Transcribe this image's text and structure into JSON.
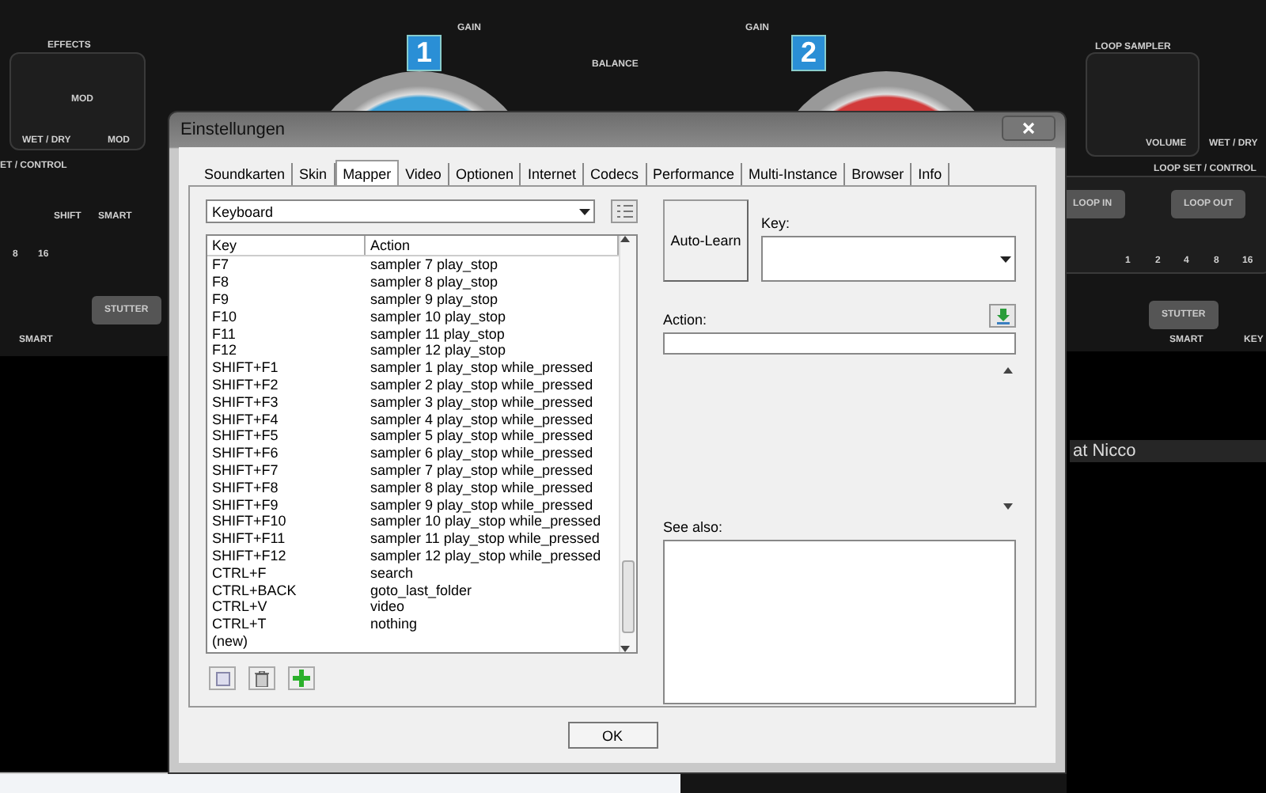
{
  "background_labels": [
    {
      "kind": "label",
      "text": "EFFECTS"
    },
    {
      "kind": "label",
      "text": "MOD"
    },
    {
      "kind": "label",
      "text": "WET / DRY"
    },
    {
      "kind": "label",
      "text": "MOD"
    },
    {
      "kind": "label",
      "text": "ET / CONTROL"
    },
    {
      "kind": "label",
      "text": "SHIFT"
    },
    {
      "kind": "label",
      "text": "SMART"
    },
    {
      "kind": "label",
      "text": "8"
    },
    {
      "kind": "label",
      "text": "16"
    },
    {
      "kind": "button",
      "text": "STUTTER"
    },
    {
      "kind": "label",
      "text": "SMART"
    },
    {
      "kind": "deck",
      "text": "1"
    },
    {
      "kind": "label",
      "text": "GAIN"
    },
    {
      "kind": "label",
      "text": "BALANCE"
    },
    {
      "kind": "label",
      "text": "GAIN"
    },
    {
      "kind": "deck",
      "text": "2"
    },
    {
      "kind": "label",
      "text": "LOOP SAMPLER"
    },
    {
      "kind": "label",
      "text": "VOLUME"
    },
    {
      "kind": "label",
      "text": "WET / DRY"
    },
    {
      "kind": "label",
      "text": "LOOP SET / CONTROL"
    },
    {
      "kind": "button",
      "text": "LOOP IN"
    },
    {
      "kind": "button",
      "text": "LOOP OUT"
    },
    {
      "kind": "label",
      "text": "1"
    },
    {
      "kind": "label",
      "text": "2"
    },
    {
      "kind": "label",
      "text": "4"
    },
    {
      "kind": "label",
      "text": "8"
    },
    {
      "kind": "label",
      "text": "16"
    },
    {
      "kind": "button",
      "text": "STUTTER"
    },
    {
      "kind": "label",
      "text": "SMART"
    },
    {
      "kind": "label",
      "text": "KEY"
    },
    {
      "kind": "row",
      "text": "at Nicco"
    }
  ],
  "window": {
    "title": "Einstellungen"
  },
  "tabs": [
    {
      "label": "Soundkarten",
      "selected": false
    },
    {
      "label": "Skin",
      "selected": false
    },
    {
      "label": "Mapper",
      "selected": true
    },
    {
      "label": "Video",
      "selected": false
    },
    {
      "label": "Optionen",
      "selected": false
    },
    {
      "label": "Internet",
      "selected": false
    },
    {
      "label": "Codecs",
      "selected": false
    },
    {
      "label": "Performance",
      "selected": false
    },
    {
      "label": "Multi-Instance",
      "selected": false
    },
    {
      "label": "Browser",
      "selected": false
    },
    {
      "label": "Info",
      "selected": false
    }
  ],
  "device": {
    "value": "Keyboard"
  },
  "table": {
    "columns": [
      "Key",
      "Action"
    ],
    "rows": [
      {
        "key": "F7",
        "action": "sampler  7 play_stop"
      },
      {
        "key": "F8",
        "action": "sampler  8 play_stop"
      },
      {
        "key": "F9",
        "action": "sampler  9 play_stop"
      },
      {
        "key": "F10",
        "action": "sampler  10 play_stop"
      },
      {
        "key": "F11",
        "action": "sampler  11 play_stop"
      },
      {
        "key": "F12",
        "action": "sampler  12 play_stop"
      },
      {
        "key": "SHIFT+F1",
        "action": "sampler  1 play_stop while_pressed"
      },
      {
        "key": "SHIFT+F2",
        "action": "sampler  2 play_stop while_pressed"
      },
      {
        "key": "SHIFT+F3",
        "action": "sampler  3 play_stop while_pressed"
      },
      {
        "key": "SHIFT+F4",
        "action": "sampler  4 play_stop while_pressed"
      },
      {
        "key": "SHIFT+F5",
        "action": "sampler  5 play_stop while_pressed"
      },
      {
        "key": "SHIFT+F6",
        "action": "sampler  6 play_stop while_pressed"
      },
      {
        "key": "SHIFT+F7",
        "action": "sampler  7 play_stop while_pressed"
      },
      {
        "key": "SHIFT+F8",
        "action": "sampler  8 play_stop while_pressed"
      },
      {
        "key": "SHIFT+F9",
        "action": "sampler  9 play_stop while_pressed"
      },
      {
        "key": "SHIFT+F10",
        "action": "sampler  10 play_stop while_pressed"
      },
      {
        "key": "SHIFT+F11",
        "action": "sampler  11 play_stop while_pressed"
      },
      {
        "key": "SHIFT+F12",
        "action": "sampler  12 play_stop while_pressed"
      },
      {
        "key": "CTRL+F",
        "action": "search"
      },
      {
        "key": "CTRL+BACK",
        "action": "goto_last_folder"
      },
      {
        "key": "CTRL+V",
        "action": "video"
      },
      {
        "key": "CTRL+T",
        "action": "nothing"
      },
      {
        "key": "(new)",
        "action": ""
      }
    ]
  },
  "auto_learn": "Auto-Learn",
  "key_label": "Key:",
  "action_label": "Action:",
  "see_also_label": "See also:",
  "ok": "OK"
}
